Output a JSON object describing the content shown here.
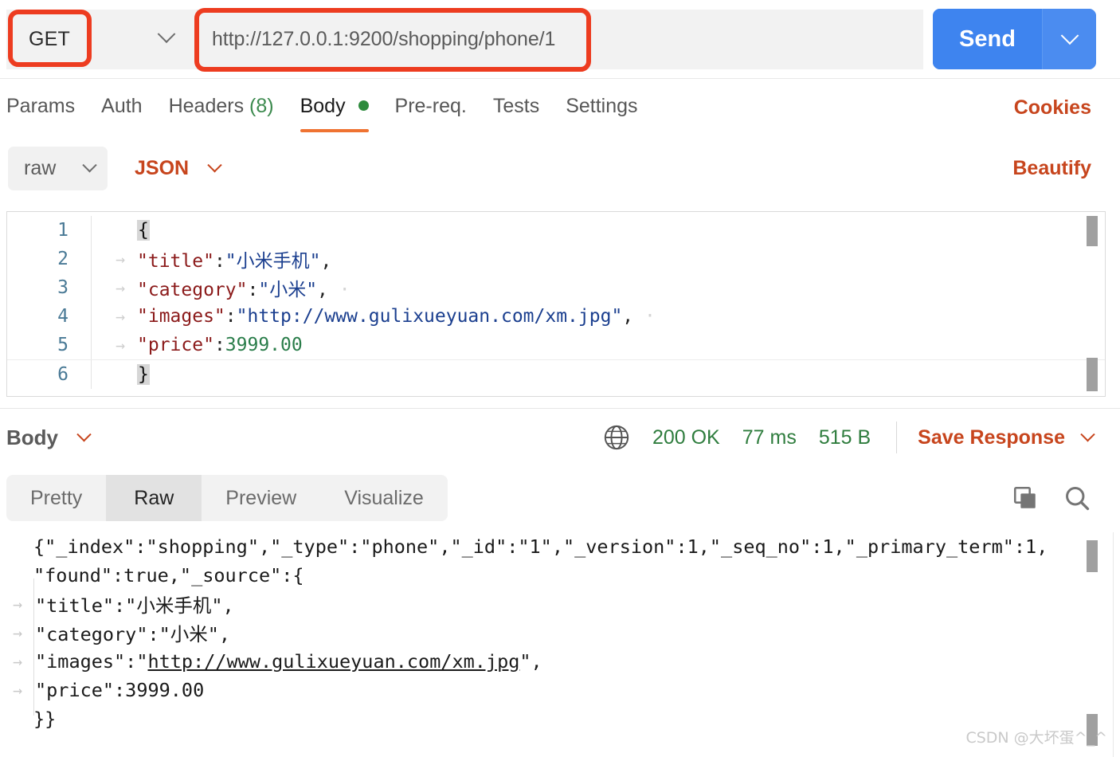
{
  "request_bar": {
    "method": "GET",
    "method_dropdown_icon": "chevron-down-icon",
    "url": "http://127.0.0.1:9200/shopping/phone/1",
    "send_label": "Send",
    "send_dropdown_icon": "chevron-down-icon"
  },
  "request_tabs": {
    "items": [
      {
        "label": "Params",
        "active": false
      },
      {
        "label": "Auth",
        "active": false
      },
      {
        "label": "Headers",
        "count": "(8)",
        "active": false
      },
      {
        "label": "Body",
        "active": true,
        "has_dot": true
      },
      {
        "label": "Pre-req.",
        "active": false
      },
      {
        "label": "Tests",
        "active": false
      },
      {
        "label": "Settings",
        "active": false
      }
    ],
    "cookies_label": "Cookies"
  },
  "body_type_row": {
    "mode": "raw",
    "mode_icon": "chevron-down-icon",
    "format": "JSON",
    "format_icon": "chevron-down-icon",
    "beautify_label": "Beautify"
  },
  "request_body": {
    "lines": [
      {
        "num": "1",
        "indent": false,
        "open_brace": "{"
      },
      {
        "num": "2",
        "indent": true,
        "key": "\"title\"",
        "colon": ":",
        "value": "\"小米手机\"",
        "value_type": "string",
        "comma": ","
      },
      {
        "num": "3",
        "indent": true,
        "key": "\"category\"",
        "colon": ":",
        "value": "\"小米\"",
        "value_type": "string",
        "comma": ","
      },
      {
        "num": "4",
        "indent": true,
        "key": "\"images\"",
        "colon": ":",
        "value": "\"http://www.gulixueyuan.com/xm.jpg\"",
        "value_type": "string",
        "comma": ","
      },
      {
        "num": "5",
        "indent": true,
        "key": "\"price\"",
        "colon": ":",
        "value": "3999.00",
        "value_type": "number",
        "comma": ""
      },
      {
        "num": "6",
        "indent": false,
        "close_brace": "}"
      }
    ]
  },
  "response_header": {
    "body_label": "Body",
    "body_icon": "chevron-down-icon",
    "globe_icon": "globe-icon",
    "status": "200 OK",
    "time": "77 ms",
    "size": "515 B",
    "save_response_label": "Save Response",
    "save_response_icon": "chevron-down-icon"
  },
  "response_tabs": {
    "items": [
      {
        "label": "Pretty",
        "active": false
      },
      {
        "label": "Raw",
        "active": true
      },
      {
        "label": "Preview",
        "active": false
      },
      {
        "label": "Visualize",
        "active": false
      }
    ],
    "copy_icon": "copy-icon",
    "search_icon": "search-icon"
  },
  "response_body": {
    "lines": [
      {
        "type": "plain",
        "text": "{\"_index\":\"shopping\",\"_type\":\"phone\",\"_id\":\"1\",\"_version\":1,\"_seq_no\":1,\"_primary_term\":1,"
      },
      {
        "type": "plain",
        "text": "\"found\":true,\"_source\":{"
      },
      {
        "type": "indent",
        "text": "\"title\":\"小米手机\","
      },
      {
        "type": "indent",
        "text": "\"category\":\"小米\","
      },
      {
        "type": "indent_link",
        "prefix": "\"images\":\"",
        "link": "http://www.gulixueyuan.com/xm.jpg",
        "suffix": "\","
      },
      {
        "type": "indent",
        "text": "\"price\":3999.00"
      },
      {
        "type": "plain",
        "text": "}}"
      }
    ]
  },
  "watermark": {
    "text": "CSDN @大坏蛋^_^"
  },
  "colors": {
    "accent_orange": "#c7451d",
    "send_blue": "#3e84ef",
    "status_green": "#2f7d3e",
    "annotation_red": "#ed3c20",
    "tab_underline": "#ef7332"
  }
}
